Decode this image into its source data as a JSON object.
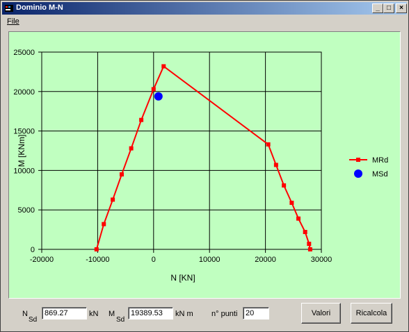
{
  "window": {
    "title": "Dominio M-N"
  },
  "menu": {
    "file": "File"
  },
  "chart_data": {
    "type": "line",
    "xlabel": "N [KN]",
    "ylabel": "M [KNm]",
    "xlim": [
      -20000,
      30000
    ],
    "ylim": [
      0,
      25000
    ],
    "xticks": [
      "-20000",
      "-10000",
      "0",
      "10000",
      "20000",
      "30000"
    ],
    "yticks": [
      "0",
      "5000",
      "10000",
      "15000",
      "20000",
      "25000"
    ],
    "grid": true,
    "legend_position": "right",
    "series": [
      {
        "name": "MRd",
        "color": "#ff0000",
        "marker": "square",
        "x": [
          -10200,
          -8900,
          -7300,
          -5700,
          -4000,
          -2200,
          0,
          1800,
          20500,
          21900,
          23300,
          24700,
          25900,
          27100,
          27800,
          28000
        ],
        "y": [
          0,
          3200,
          6300,
          9500,
          12800,
          16400,
          20300,
          23200,
          13300,
          10700,
          8100,
          5900,
          3900,
          2200,
          700,
          0
        ]
      },
      {
        "name": "MSd",
        "color": "#0000ff",
        "marker": "circle",
        "x": [
          869.27
        ],
        "y": [
          19389.53
        ]
      }
    ]
  },
  "form": {
    "nsd_label": "N",
    "nsd_sub": "Sd",
    "nsd_value": "869.27",
    "nsd_unit": "kN",
    "msd_label": "M",
    "msd_sub": "Sd",
    "msd_value": "19389.53",
    "msd_unit": "kN m",
    "npunti_label": "n° punti",
    "npunti_value": "20",
    "valori_button": "Valori",
    "ricalcola_button": "Ricalcola"
  }
}
